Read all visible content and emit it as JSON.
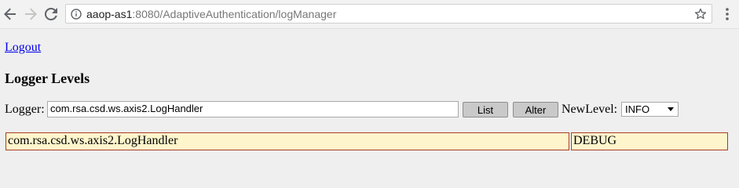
{
  "browser": {
    "url_host": "aaop-as1",
    "url_rest": ":8080/AdaptiveAuthentication/logManager",
    "icons": [
      "back-arrow-icon",
      "forward-arrow-icon",
      "reload-icon",
      "info-icon",
      "star-icon",
      "kebab-menu-icon"
    ]
  },
  "page": {
    "logout_link": "Logout",
    "heading": "Logger Levels",
    "logger_label": "Logger:",
    "logger_value": "com.rsa.csd.ws.axis2.LogHandler",
    "list_button": "List",
    "alter_button": "Alter",
    "newlevel_label": "NewLevel:",
    "newlevel_selected": "INFO"
  },
  "results": [
    {
      "logger": "com.rsa.csd.ws.axis2.LogHandler",
      "level": "DEBUG"
    }
  ],
  "colors": {
    "result_bg": "#fff5cc",
    "result_border": "#a63d25",
    "link": "#0000ee"
  }
}
